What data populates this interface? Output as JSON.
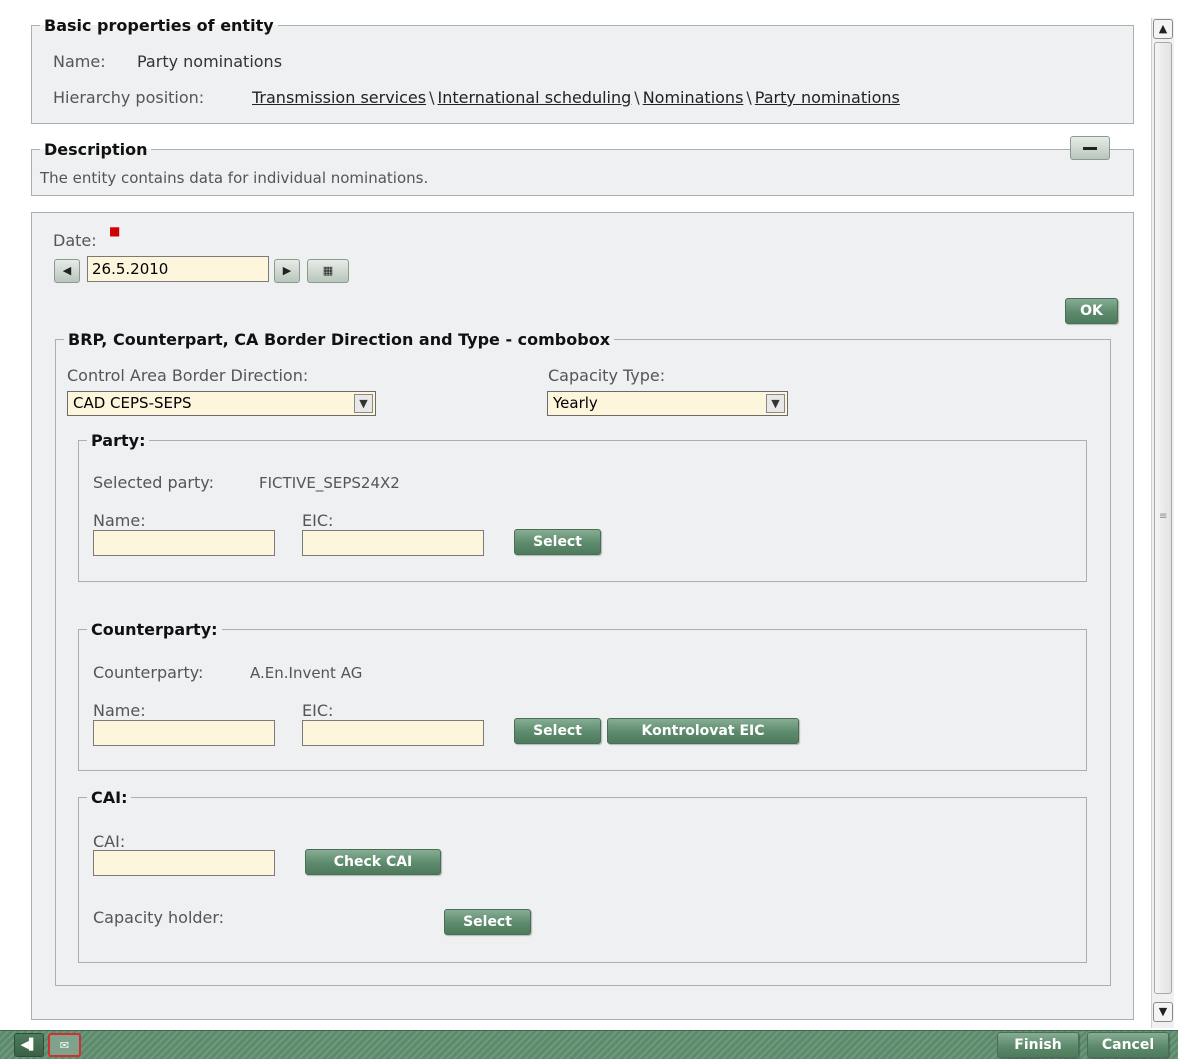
{
  "basic": {
    "legend": "Basic properties of entity",
    "name_label": "Name:",
    "name_value": "Party nominations",
    "hierarchy_label": "Hierarchy position:",
    "hierarchy": [
      "Transmission services",
      "International scheduling",
      "Nominations",
      "Party nominations"
    ]
  },
  "description": {
    "legend": "Description",
    "text": "The entity contains data for individual nominations.",
    "collapse_icon": "minus-icon"
  },
  "filter": {
    "date_label": "Date:",
    "date_value": "26.5.2010",
    "ok_label": "OK"
  },
  "combo": {
    "legend": "BRP, Counterpart, CA Border Direction and Type - combobox",
    "cad_label": "Control Area Border Direction:",
    "cad_value": "CAD CEPS-SEPS",
    "cap_label": "Capacity Type:",
    "cap_value": "Yearly"
  },
  "party": {
    "legend": "Party:",
    "selected_label": "Selected party:",
    "selected_value": "FICTIVE_SEPS24X2",
    "name_label": "Name:",
    "eic_label": "EIC:",
    "select_label": "Select"
  },
  "counterparty": {
    "legend": "Counterparty:",
    "selected_label": "Counterparty:",
    "selected_value": "A.En.Invent AG",
    "name_label": "Name:",
    "eic_label": "EIC:",
    "select_label": "Select",
    "check_eic_label": "Kontrolovat EIC"
  },
  "cai": {
    "legend": "CAI:",
    "cai_label": "CAI:",
    "check_label": "Check CAI",
    "holder_label": "Capacity holder:",
    "select_label": "Select"
  },
  "footer": {
    "finish_label": "Finish",
    "cancel_label": "Cancel"
  },
  "colors": {
    "button_green": "#5d8a6c",
    "input_bg": "#fdf6dd",
    "panel_bg": "#eef0f1",
    "required": "#d00000"
  }
}
